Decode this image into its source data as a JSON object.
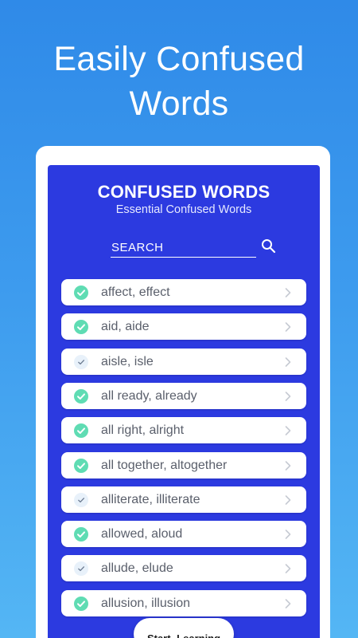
{
  "promo": {
    "title": "Easily Confused Words"
  },
  "app": {
    "title": "CONFUSED WORDS",
    "subtitle": "Essential Confused Words",
    "search": {
      "placeholder": "SEARCH",
      "value": ""
    },
    "items": [
      {
        "label": "affect, effect",
        "status": "completed"
      },
      {
        "label": "aid, aide",
        "status": "completed"
      },
      {
        "label": "aisle, isle",
        "status": "pending"
      },
      {
        "label": "all ready, already",
        "status": "completed"
      },
      {
        "label": "all right, alright",
        "status": "completed"
      },
      {
        "label": "all together, altogether",
        "status": "completed"
      },
      {
        "label": "alliterate, illiterate",
        "status": "pending"
      },
      {
        "label": "allowed, aloud",
        "status": "completed"
      },
      {
        "label": "allude, elude",
        "status": "pending"
      },
      {
        "label": "allusion, illusion",
        "status": "completed"
      }
    ],
    "start_button": "Start Learning"
  },
  "colors": {
    "background_top": "#2f8ae8",
    "background_bottom": "#54b6f4",
    "screen": "#2c3ae0",
    "completed_check": "#5fdcb3",
    "pending_check": "#e8f1fa"
  },
  "icons": {
    "search": "search-icon",
    "completed": "check-circle-filled-icon",
    "pending": "check-circle-light-icon",
    "chevron": "chevron-right-icon"
  }
}
